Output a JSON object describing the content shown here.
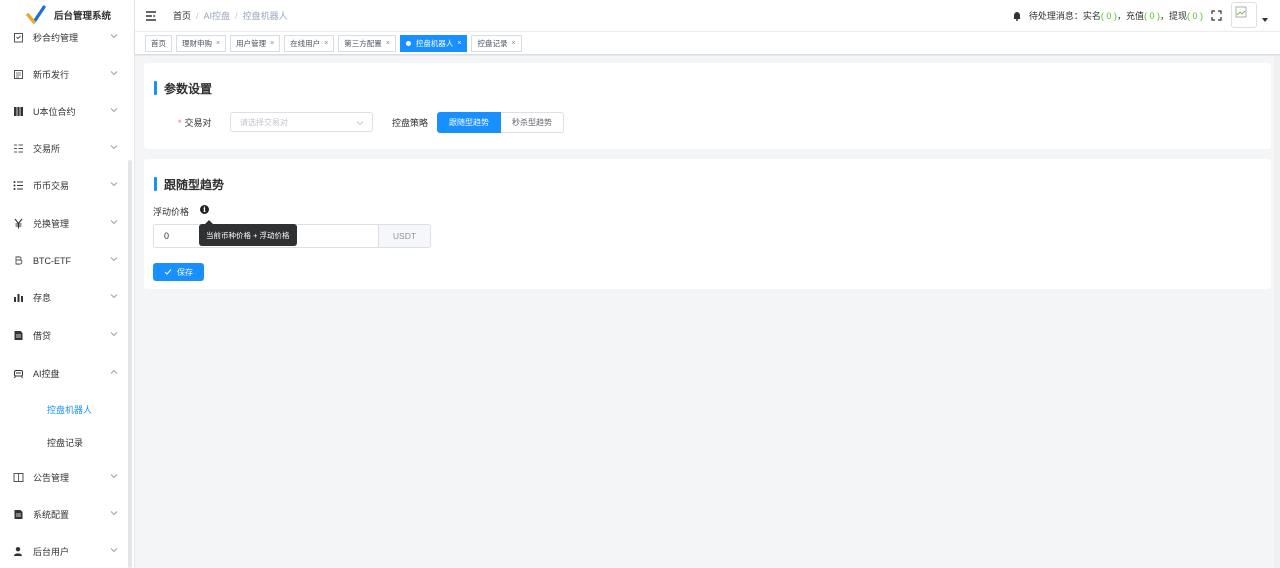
{
  "app": {
    "title": "后台管理系统"
  },
  "sidebar": {
    "items": [
      {
        "label": "秒合约管理",
        "icon": "clipboard-icon"
      },
      {
        "label": "新币发行",
        "icon": "document-icon"
      },
      {
        "label": "U本位合约",
        "icon": "grid-icon"
      },
      {
        "label": "交易所",
        "icon": "list-icon"
      },
      {
        "label": "币币交易",
        "icon": "list-bullets-icon"
      },
      {
        "label": "兑换管理",
        "icon": "yen-icon"
      },
      {
        "label": "BTC-ETF",
        "icon": "bitcoin-icon"
      },
      {
        "label": "存息",
        "icon": "bar-chart-icon"
      },
      {
        "label": "借贷",
        "icon": "file-icon"
      },
      {
        "label": "AI控盘",
        "icon": "robot-icon"
      },
      {
        "label": "公告管理",
        "icon": "book-icon"
      },
      {
        "label": "系统配置",
        "icon": "file-icon"
      },
      {
        "label": "后台用户",
        "icon": "user-icon"
      }
    ],
    "subitems": [
      {
        "label": "控盘机器人",
        "active": true
      },
      {
        "label": "控盘记录",
        "active": false
      }
    ]
  },
  "header": {
    "breadcrumb": [
      "首页",
      "AI控盘",
      "控盘机器人"
    ],
    "notice": {
      "prefix": "待处理消息：实名",
      "real_name_count": "( 0 )",
      "recharge_label": "，充值",
      "recharge_count": "( 0 )",
      "withdraw_label": "，提现",
      "withdraw_count": "( 0 )"
    }
  },
  "tags": [
    {
      "label": "首页",
      "closable": false,
      "active": false
    },
    {
      "label": "理财申购",
      "closable": true,
      "active": false
    },
    {
      "label": "用户管理",
      "closable": true,
      "active": false
    },
    {
      "label": "在线用户",
      "closable": true,
      "active": false
    },
    {
      "label": "第三方配置",
      "closable": true,
      "active": false
    },
    {
      "label": "控盘机器人",
      "closable": true,
      "active": true
    },
    {
      "label": "控盘记录",
      "closable": true,
      "active": false
    }
  ],
  "params_card": {
    "title": "参数设置",
    "pair_label": "交易对",
    "pair_placeholder": "请选择交易对",
    "strategy_label": "控盘策略",
    "strategy_options": [
      "跟随型趋势",
      "秒杀型趋势"
    ],
    "strategy_selected": "跟随型趋势"
  },
  "trend_card": {
    "title": "跟随型趋势",
    "float_price_label": "浮动价格",
    "float_price_value": "0",
    "unit": "USDT",
    "tooltip": "当前币种价格 + 浮动价格",
    "save_label": "保存"
  },
  "colors": {
    "primary": "#1890ff",
    "success": "#52c41a",
    "danger": "#f56c6c"
  }
}
